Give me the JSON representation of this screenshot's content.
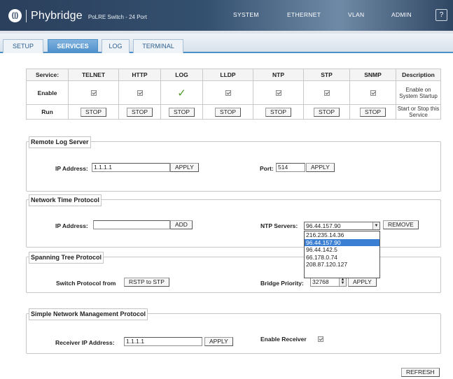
{
  "header": {
    "logo_mark": "(|)",
    "brand": "Phybridge",
    "product": "PoLRE Switch - 24 Port",
    "nav": [
      "SYSTEM",
      "ETHERNET",
      "VLAN",
      "ADMIN"
    ],
    "help": "?"
  },
  "tabs": [
    "SETUP",
    "SERVICES",
    "LOG",
    "TERMINAL"
  ],
  "active_tab": "SERVICES",
  "services_table": {
    "head_label": "Service:",
    "services": [
      "TELNET",
      "HTTP",
      "LOG",
      "LLDP",
      "NTP",
      "STP",
      "SNMP"
    ],
    "description_header": "Description",
    "enable_label": "Enable",
    "enable_states": [
      true,
      true,
      true,
      true,
      true,
      true,
      true
    ],
    "enable_description": "Enable on System Startup",
    "run_label": "Run",
    "stop_label": "STOP",
    "run_description": "Start or Stop this Service",
    "check_glyph": "✓"
  },
  "remote_log": {
    "title": "Remote Log Server",
    "ip_label": "IP Address:",
    "ip_value": "1.1.1.1",
    "apply_label": "APPLY",
    "port_label": "Port:",
    "port_value": "514",
    "port_apply_label": "APPLY"
  },
  "ntp": {
    "title": "Network Time Protocol",
    "ip_label": "IP Address:",
    "ip_value": "",
    "add_label": "ADD",
    "servers_label": "NTP Servers:",
    "selected_server": "96.44.157.90",
    "remove_label": "REMOVE",
    "server_options": [
      "216.235.14.36",
      "96.44.157.90",
      "96.44.142.5",
      "66.178.0.74",
      "208.87.120.127"
    ],
    "highlighted_option": "96.44.157.90"
  },
  "stp": {
    "title": "Spanning Tree Protocol",
    "switch_label": "Switch Protocol from",
    "switch_button": "RSTP to STP",
    "priority_label": "Bridge Priority:",
    "priority_value": "32768",
    "apply_label": "APPLY"
  },
  "snmp": {
    "title": "Simple Network Management Protocol",
    "receiver_ip_label": "Receiver IP Address:",
    "receiver_ip_value": "1.1.1.1",
    "apply_label": "APPLY",
    "enable_receiver_label": "Enable Receiver",
    "enable_receiver_checked": true
  },
  "refresh_label": "REFRESH",
  "colors": {
    "header_bg": "#2a3f5c",
    "tab_accent": "#4b8fc9",
    "check_green": "#4a9a2a",
    "dropdown_highlight": "#3b7fd4"
  }
}
